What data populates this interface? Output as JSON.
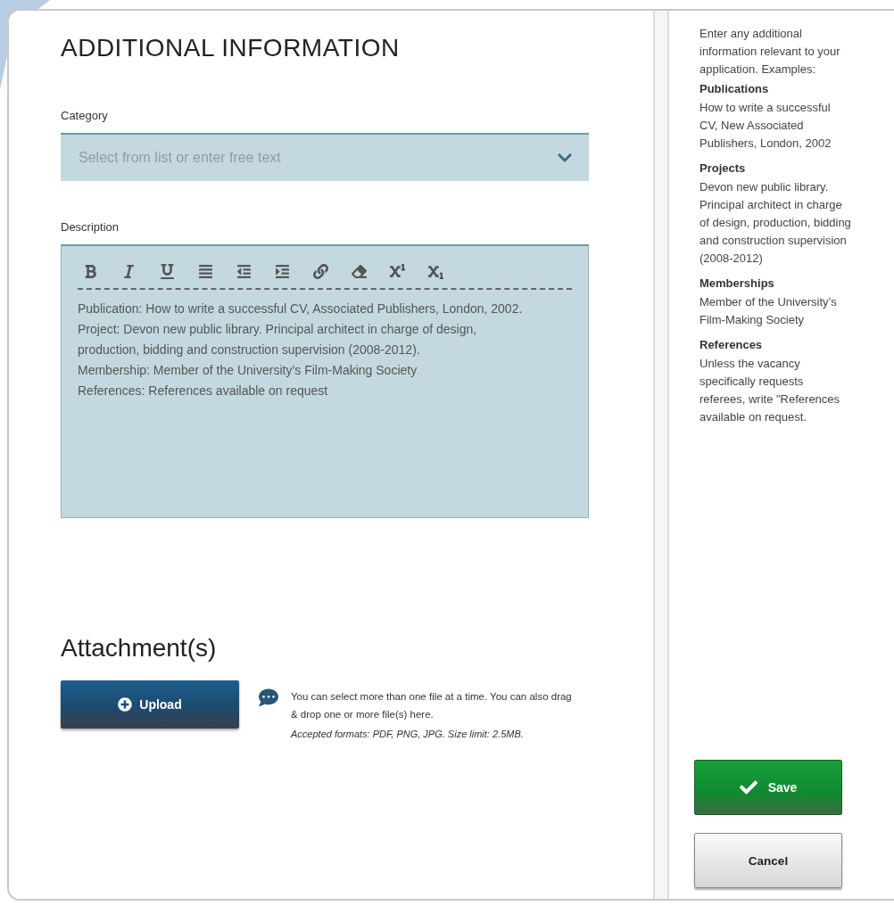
{
  "title": "ADDITIONAL INFORMATION",
  "category": {
    "label": "Category",
    "placeholder": "Select from list or enter free text"
  },
  "description": {
    "label": "Description",
    "lines": [
      "Publication: How to write a successful CV, Associated Publishers, London, 2002.",
      "Project: Devon new public library. Principal architect in charge of design, production, bidding and construction supervision (2008-2012).",
      "Membership: Member of the University’s Film-Making Society",
      "References: References available on request"
    ]
  },
  "attachments": {
    "heading": "Attachment(s)",
    "upload_button": "Upload",
    "info": "You can select more than one file at a time. You can also drag & drop one or more file(s) here.",
    "formats": "Accepted formats: PDF, PNG, JPG. Size limit: 2.5MB."
  },
  "help": {
    "intro": "Enter any additional information relevant to your application. Examples:",
    "sections": [
      {
        "heading": "Publications",
        "text": "How to write a successful CV, New Associated Publishers, London, 2002"
      },
      {
        "heading": "Projects",
        "text": "Devon new public library. Principal architect in charge of design, production, bidding and construction supervision (2008-2012)"
      },
      {
        "heading": "Memberships",
        "text": "Member of the University’s Film-Making Society"
      },
      {
        "heading": "References",
        "text": "Unless the vacancy specifically requests referees, write \"References available on request."
      }
    ]
  },
  "buttons": {
    "save": "Save",
    "cancel": "Cancel"
  }
}
